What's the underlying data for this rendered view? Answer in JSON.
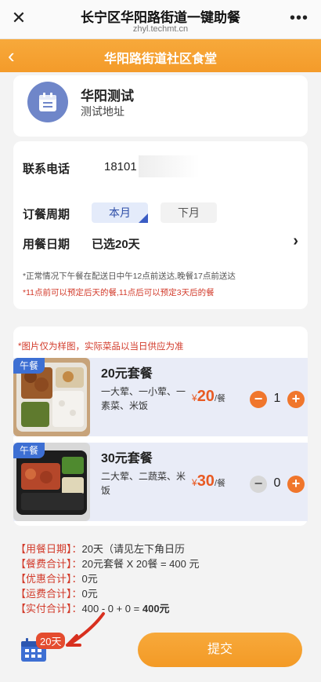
{
  "browser": {
    "title": "长宁区华阳路街道一键助餐",
    "url": "zhyl.techmt.cn",
    "close_icon": "close-icon",
    "more_icon": "more-dots-icon"
  },
  "nav": {
    "title": "华阳路街道社区食堂",
    "back_icon": "chevron-left-icon"
  },
  "profile": {
    "name": "华阳测试",
    "address": "测试地址",
    "avatar_icon": "calendar-icon"
  },
  "form": {
    "phone_label": "联系电话",
    "phone_value": "18101",
    "period_label": "订餐周期",
    "period_this": "本月",
    "period_next": "下月",
    "date_label": "用餐日期",
    "date_value": "已选20天",
    "note_gray": "*正常情况下午餐在配送日中午12点前送达,晚餐17点前送达",
    "note_red": "*11点前可以预定后天的餐,11点后可以预定3天后的餐"
  },
  "meals": {
    "notice": "*图片仅为样图，实际菜品以当日供应为准",
    "items": [
      {
        "tag": "午餐",
        "name": "20元套餐",
        "desc": "一大荤、一小荤、一素菜、米饭",
        "currency": "¥",
        "price": "20",
        "unit": "/餐",
        "qty": "1"
      },
      {
        "tag": "午餐",
        "name": "30元套餐",
        "desc": "二大荤、二蔬菜、米饭",
        "currency": "¥",
        "price": "30",
        "unit": "/餐",
        "qty": "0"
      }
    ]
  },
  "summary": {
    "lines": [
      {
        "key": "【用餐日期】：",
        "value": "20天（请见左下角日历"
      },
      {
        "key": "【餐费合计】：",
        "value": "20元套餐 X 20餐 = 400 元"
      },
      {
        "key": "【优惠合计】：",
        "value": "0元"
      },
      {
        "key": "【运费合计】：",
        "value": "0元"
      },
      {
        "key": "【实付合计】：",
        "value": "400 - 0 + 0 = ",
        "value_bold": "400元"
      }
    ]
  },
  "footer": {
    "days_badge": "20天",
    "submit_label": "提交",
    "calendar_icon": "calendar-icon",
    "arrow_icon": "arrow-annotation-icon"
  },
  "colors": {
    "brand_orange": "#f49b2a",
    "accent_blue": "#3d6fd3",
    "alert_red": "#d23a2a"
  }
}
